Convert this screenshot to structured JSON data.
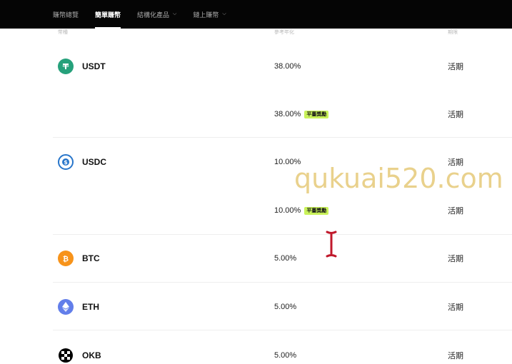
{
  "nav": {
    "items": [
      {
        "label": "賺幣總覽",
        "active": false,
        "dropdown": false
      },
      {
        "label": "簡單賺幣",
        "active": true,
        "dropdown": false
      },
      {
        "label": "結構化產品",
        "active": false,
        "dropdown": true
      },
      {
        "label": "鏈上賺幣",
        "active": false,
        "dropdown": true
      }
    ]
  },
  "table": {
    "headers": {
      "asset": "幣種",
      "rate": "參考年化",
      "term": "期限"
    },
    "rows": [
      {
        "asset": "USDT",
        "icon": "usdt-icon",
        "rate": "38.00%",
        "bonus": "",
        "term": "活期"
      },
      {
        "asset": "",
        "icon": "",
        "rate": "38.00%",
        "bonus": "平臺獎勵",
        "term": "活期"
      },
      {
        "asset": "USDC",
        "icon": "usdc-icon",
        "rate": "10.00%",
        "bonus": "",
        "term": "活期"
      },
      {
        "asset": "",
        "icon": "",
        "rate": "10.00%",
        "bonus": "平臺獎勵",
        "term": "活期"
      },
      {
        "asset": "BTC",
        "icon": "btc-icon",
        "rate": "5.00%",
        "bonus": "",
        "term": "活期"
      },
      {
        "asset": "ETH",
        "icon": "eth-icon",
        "rate": "5.00%",
        "bonus": "",
        "term": "活期"
      },
      {
        "asset": "OKB",
        "icon": "okb-icon",
        "rate": "5.00%",
        "bonus": "",
        "term": "活期"
      }
    ]
  },
  "watermark": "qukuai520.com",
  "colors": {
    "usdt": "#26a17b",
    "usdc": "#2775ca",
    "btc": "#f7931a",
    "eth": "#627eea",
    "okb": "#000000",
    "bonus_bg": "#c9f25a"
  }
}
